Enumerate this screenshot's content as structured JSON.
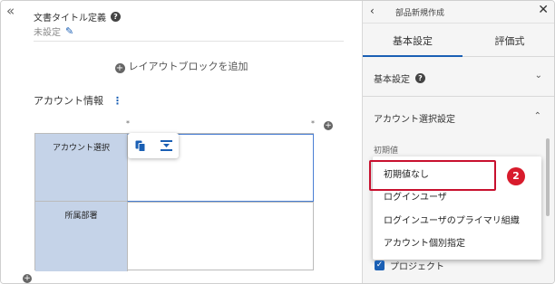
{
  "left": {
    "collapse_icon": "double-chevron-left-icon",
    "doc_title_label": "文書タイトル定義",
    "doc_title_value": "未設定",
    "add_block_label": "レイアウトブロックを追加",
    "section_title": "アカウント情報",
    "rows": [
      {
        "header": "アカウント選択"
      },
      {
        "header": "所属部署"
      }
    ],
    "marker": "*"
  },
  "right": {
    "back_icon": "chevron-left-icon",
    "title": "部品新規作成",
    "close_icon": "close-icon",
    "tabs": [
      {
        "label": "基本設定"
      },
      {
        "label": "評価式"
      }
    ],
    "accordion_basic": "基本設定",
    "accordion_account": "アカウント選択設定",
    "field_label": "初期値",
    "dropdown_options": [
      "初期値なし",
      "ログインユーザ",
      "ログインユーザのプライマリ組織",
      "アカウント個別指定"
    ],
    "checkbox_label": "プロジェクト",
    "badge_number": "2"
  },
  "colors": {
    "accent": "#1a5fb4",
    "highlight": "#c8102e",
    "header_cell": "#c5d3e8"
  }
}
